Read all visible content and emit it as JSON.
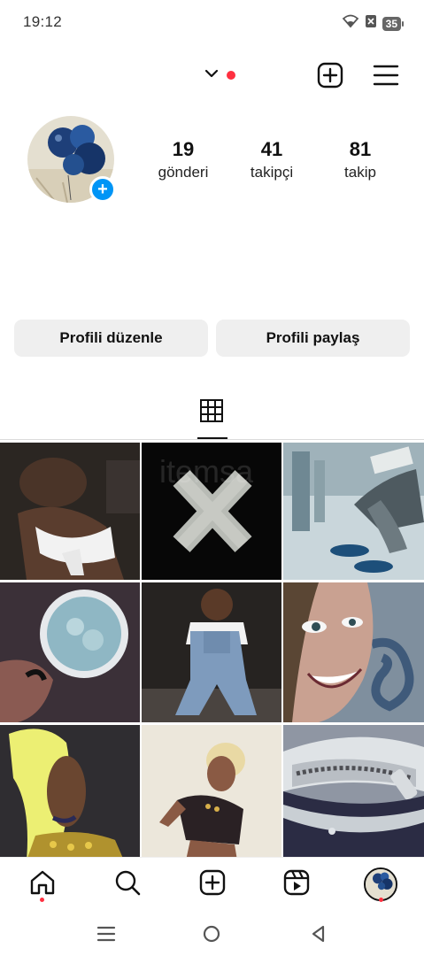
{
  "status_bar": {
    "time": "19:12",
    "battery": "35",
    "icons": [
      "wifi-icon",
      "no-sim-icon",
      "battery-icon"
    ]
  },
  "header": {
    "username": "",
    "icons": [
      "chevron-down-icon",
      "new-post-icon",
      "menu-icon"
    ],
    "notification_color": "#ff3040"
  },
  "profile": {
    "stats": [
      {
        "value": "19",
        "label": "gönderi"
      },
      {
        "value": "41",
        "label": "takipçi"
      },
      {
        "value": "81",
        "label": "takip"
      }
    ],
    "add_story_icon": "plus-icon"
  },
  "actions": {
    "edit_label": "Profili düzenle",
    "share_label": "Profili paylaş"
  },
  "tabs": {
    "active": "grid-icon"
  },
  "posts": {
    "count_visible": 9
  },
  "bottom_nav": {
    "items": [
      "home-icon",
      "search-icon",
      "create-icon",
      "reels-icon",
      "profile-avatar"
    ]
  },
  "system_nav": {
    "items": [
      "recents-icon",
      "home-circle-icon",
      "back-icon"
    ]
  },
  "colors": {
    "accent_blue": "#0095f6",
    "button_bg": "#efefef",
    "badge_red": "#ff3040"
  }
}
